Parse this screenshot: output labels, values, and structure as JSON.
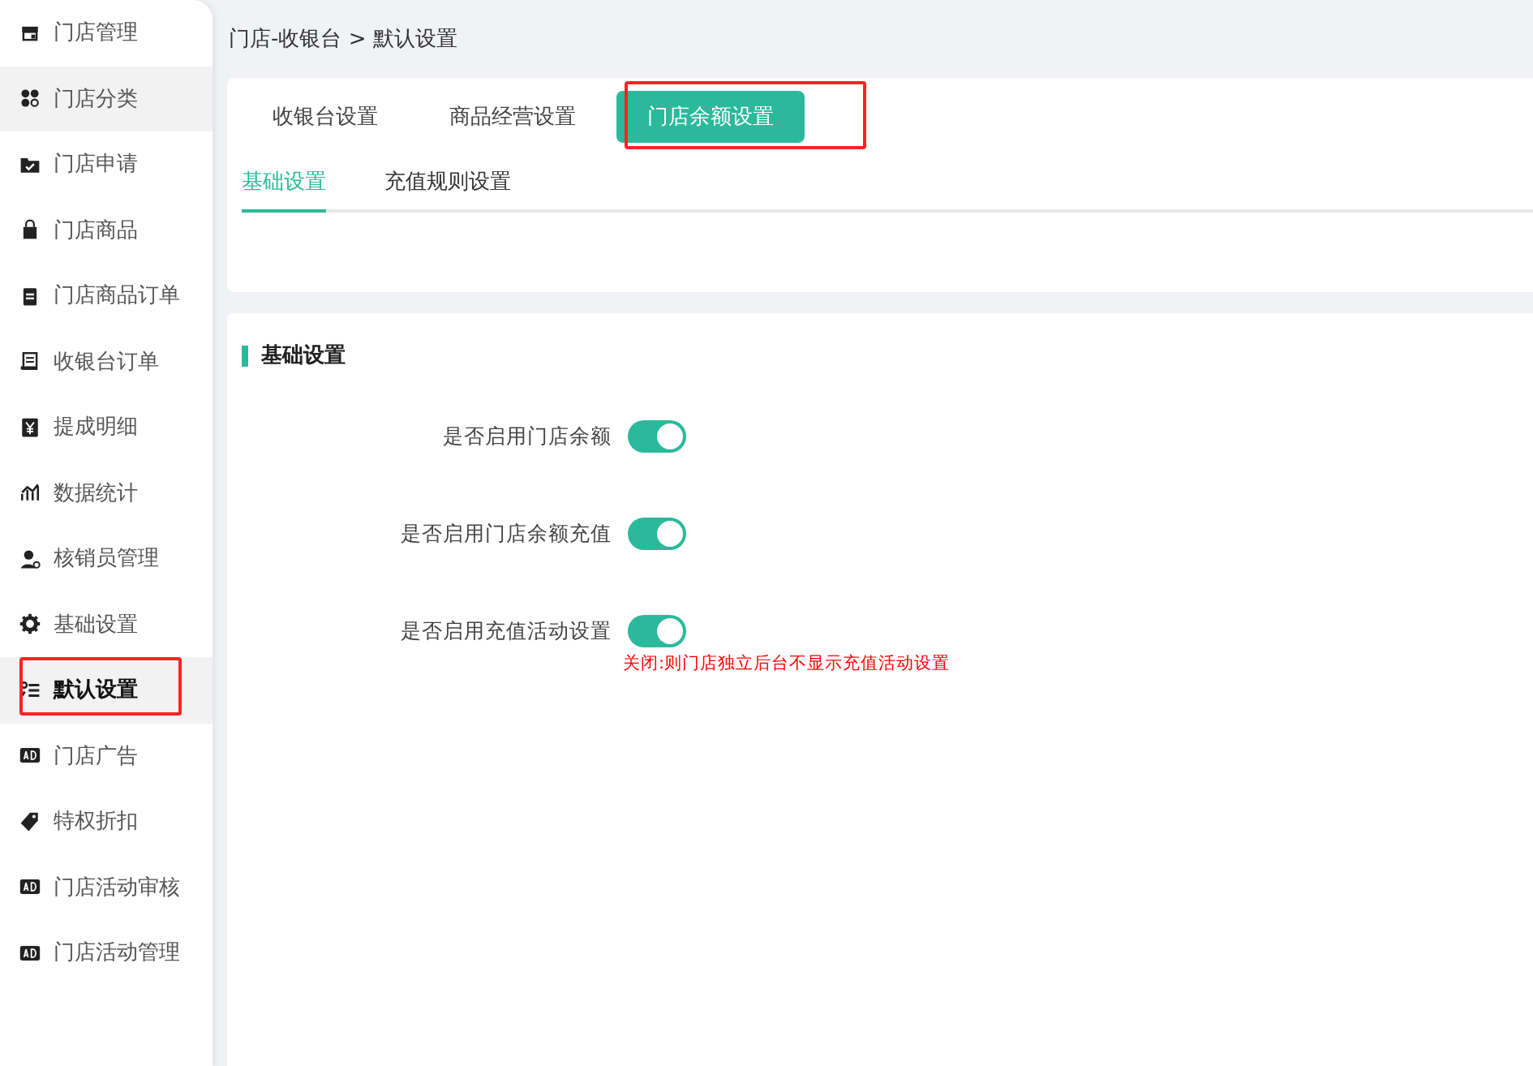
{
  "sidebar": {
    "items": [
      {
        "label": "门店管理",
        "kind": "store",
        "selected": false,
        "hovered": false,
        "highlighted": false
      },
      {
        "label": "门店分类",
        "kind": "grid",
        "selected": false,
        "hovered": true,
        "highlighted": false
      },
      {
        "label": "门店申请",
        "kind": "folder",
        "selected": false,
        "hovered": false,
        "highlighted": false
      },
      {
        "label": "门店商品",
        "kind": "bag",
        "selected": false,
        "hovered": false,
        "highlighted": false
      },
      {
        "label": "门店商品订单",
        "kind": "clipboard",
        "selected": false,
        "hovered": false,
        "highlighted": false
      },
      {
        "label": "收银台订单",
        "kind": "receipt",
        "selected": false,
        "hovered": false,
        "highlighted": false
      },
      {
        "label": "提成明细",
        "kind": "yen",
        "selected": false,
        "hovered": false,
        "highlighted": false
      },
      {
        "label": "数据统计",
        "kind": "chart",
        "selected": false,
        "hovered": false,
        "highlighted": false
      },
      {
        "label": "核销员管理",
        "kind": "user",
        "selected": false,
        "hovered": false,
        "highlighted": false
      },
      {
        "label": "基础设置",
        "kind": "gear",
        "selected": false,
        "hovered": false,
        "highlighted": false
      },
      {
        "label": "默认设置",
        "kind": "list",
        "selected": true,
        "hovered": false,
        "highlighted": true
      },
      {
        "label": "门店广告",
        "kind": "ad",
        "selected": false,
        "hovered": false,
        "highlighted": false
      },
      {
        "label": "特权折扣",
        "kind": "tag",
        "selected": false,
        "hovered": false,
        "highlighted": false
      },
      {
        "label": "门店活动审核",
        "kind": "ad",
        "selected": false,
        "hovered": false,
        "highlighted": false
      },
      {
        "label": "门店活动管理",
        "kind": "ad",
        "selected": false,
        "hovered": false,
        "highlighted": false
      }
    ]
  },
  "breadcrumb": "门店-收银台 > 默认设置",
  "tabs": [
    {
      "label": "收银台设置",
      "selected": false,
      "highlighted": false
    },
    {
      "label": "商品经营设置",
      "selected": false,
      "highlighted": false
    },
    {
      "label": "门店余额设置",
      "selected": true,
      "highlighted": true
    }
  ],
  "subtabs": [
    {
      "label": "基础设置",
      "selected": true
    },
    {
      "label": "充值规则设置",
      "selected": false
    }
  ],
  "section_title": "基础设置",
  "settings": [
    {
      "label": "是否启用门店余额",
      "on": true
    },
    {
      "label": "是否启用门店余额充值",
      "on": true
    },
    {
      "label": "是否启用充值活动设置",
      "on": true,
      "note": "关闭:则门店独立后台不显示充值活动设置"
    }
  ]
}
